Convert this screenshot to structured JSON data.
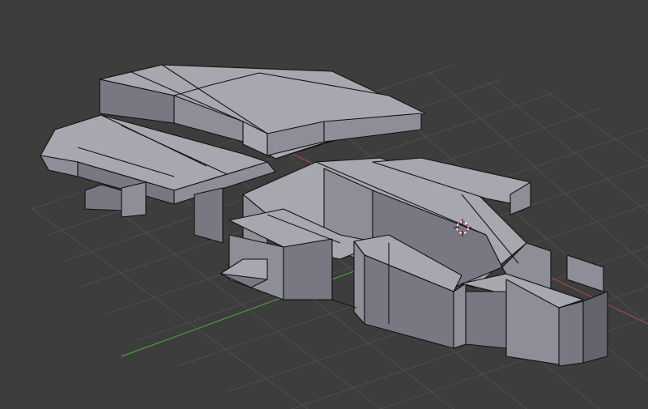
{
  "viewport": {
    "background_color": "#3d3d3d",
    "grid_color": "#4f4f4f",
    "x_axis_color": "#a04848",
    "y_axis_color": "#4a9a3c"
  },
  "scene": {
    "object": "ship-mesh",
    "shading": "solid-with-wireframe",
    "mesh_colors": {
      "top": "#a7a7b0",
      "side": "#8e8e98",
      "front": "#787882",
      "edge": "#151515"
    },
    "cursor_icon": "3d-cursor-icon"
  }
}
